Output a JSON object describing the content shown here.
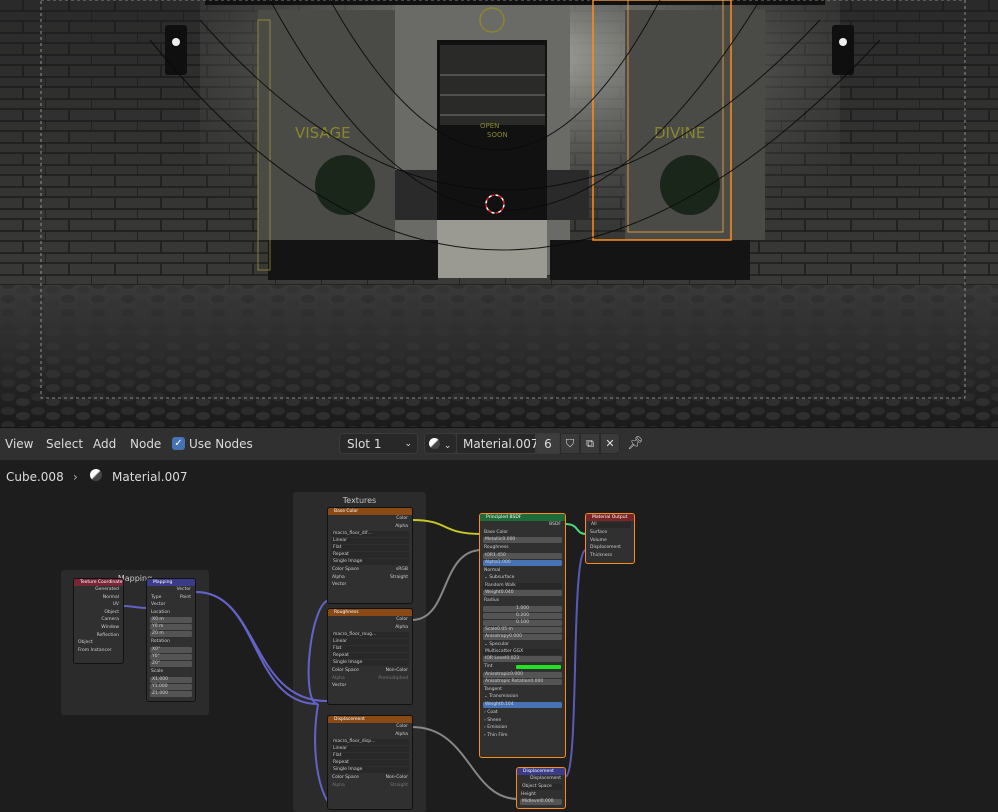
{
  "header": {
    "menus": [
      "View",
      "Select",
      "Add",
      "Node"
    ],
    "use_nodes_label": "Use Nodes",
    "slot": "Slot 1",
    "material_name": "Material.007",
    "user_count": "6"
  },
  "breadcrumb": {
    "object": "Cube.008",
    "material": "Material.007"
  },
  "viewport": {
    "sign_left": "VISAGE",
    "sign_right": "DIVINE",
    "sign_center": "OPEN\nSOON"
  },
  "frames": {
    "mapping": "Mapping",
    "textures": "Textures"
  },
  "nodes": {
    "tex_coord": {
      "title": "Texture Coordinate",
      "outputs": [
        "Generated",
        "Normal",
        "UV",
        "Object",
        "Camera",
        "Window",
        "Reflection"
      ],
      "object_label": "Object",
      "from_instancer": "From Instancer"
    },
    "mapping": {
      "title": "Mapping",
      "output": "Vector",
      "type_label": "Type",
      "type_value": "Point",
      "vector": "Vector",
      "location": "Location",
      "loc": [
        "0 m",
        "0 m",
        "0 m"
      ],
      "rotation": "Rotation",
      "rot": [
        "0°",
        "0°",
        "0°"
      ],
      "scale": "Scale",
      "scl": [
        "1.000",
        "1.000",
        "1.000"
      ]
    },
    "base_color": {
      "title": "Base Color",
      "outputs": [
        "Color",
        "Alpha"
      ],
      "image": "macro_floor_dif…",
      "interp": "Linear",
      "proj": "Flat",
      "ext": "Repeat",
      "src": "Single Image",
      "cs_label": "Color Space",
      "cs_value": "sRGB",
      "alpha_label": "Alpha",
      "alpha_value": "Straight",
      "vector": "Vector"
    },
    "roughness": {
      "title": "Roughness",
      "outputs": [
        "Color",
        "Alpha"
      ],
      "image": "macro_floor_roug…",
      "interp": "Linear",
      "proj": "Flat",
      "ext": "Repeat",
      "src": "Single Image",
      "cs_label": "Color Space",
      "cs_value": "Non-Color",
      "alpha_label": "Alpha",
      "alpha_value": "Premultiplied",
      "vector": "Vector"
    },
    "displacement_tex": {
      "title": "Displacement",
      "outputs": [
        "Color",
        "Alpha"
      ],
      "image": "macro_floor_disp…",
      "interp": "Linear",
      "proj": "Flat",
      "ext": "Repeat",
      "src": "Single Image",
      "cs_label": "Color Space",
      "cs_value": "Non-Color",
      "alpha_label": "Alpha",
      "alpha_value": "Straight"
    },
    "bsdf": {
      "title": "Principled BSDF",
      "out": "BSDF",
      "base_color": "Base Color",
      "metallic": "Metallic",
      "metallic_v": "0.000",
      "roughness": "Roughness",
      "ior": "IOR",
      "ior_v": "1.450",
      "alpha": "Alpha",
      "alpha_v": "1.000",
      "normal": "Normal",
      "subsurface": "Subsurface",
      "random_walk": "Random Walk",
      "weight": "Weight",
      "weight_v": "0.040",
      "radius": "Radius",
      "radius_v": [
        "1.000",
        "0.200",
        "0.100"
      ],
      "scale": "Scale",
      "scale_v": "0.05 m",
      "anisotropy": "Anisotropy",
      "anisotropy_v": "0.000",
      "specular": "Specular",
      "multiscatter": "Multiscatter GGX",
      "ior_level": "IOR Level",
      "ior_level_v": "0.023",
      "tint": "Tint",
      "spec_aniso": "Anisotropic",
      "spec_aniso_v": "0.000",
      "spec_rot": "Anisotropic Rotation",
      "spec_rot_v": "0.000",
      "tangent": "Tangent",
      "transmission": "Transmission",
      "trans_weight": "Weight",
      "trans_weight_v": "0.104",
      "coat": "Coat",
      "sheen": "Sheen",
      "emission": "Emission",
      "thin_film": "Thin Film"
    },
    "material_output": {
      "title": "Material Output",
      "target": "All",
      "inputs": [
        "Surface",
        "Volume",
        "Displacement",
        "Thickness"
      ]
    },
    "displacement": {
      "title": "Displacement",
      "out": "Displacement",
      "space": "Object Space",
      "height": "Height",
      "midlevel": "Midlevel",
      "midlevel_v": "0.000"
    }
  },
  "colors": {
    "accent": "#4772b3",
    "selection": "#ff8c1a",
    "tex_header": "#8a4a16",
    "shader_header": "#1f6b38",
    "output_header": "#7a2525",
    "vector_header": "#3b3b8a",
    "input_header": "#7a2535",
    "tint": "#22e322"
  }
}
